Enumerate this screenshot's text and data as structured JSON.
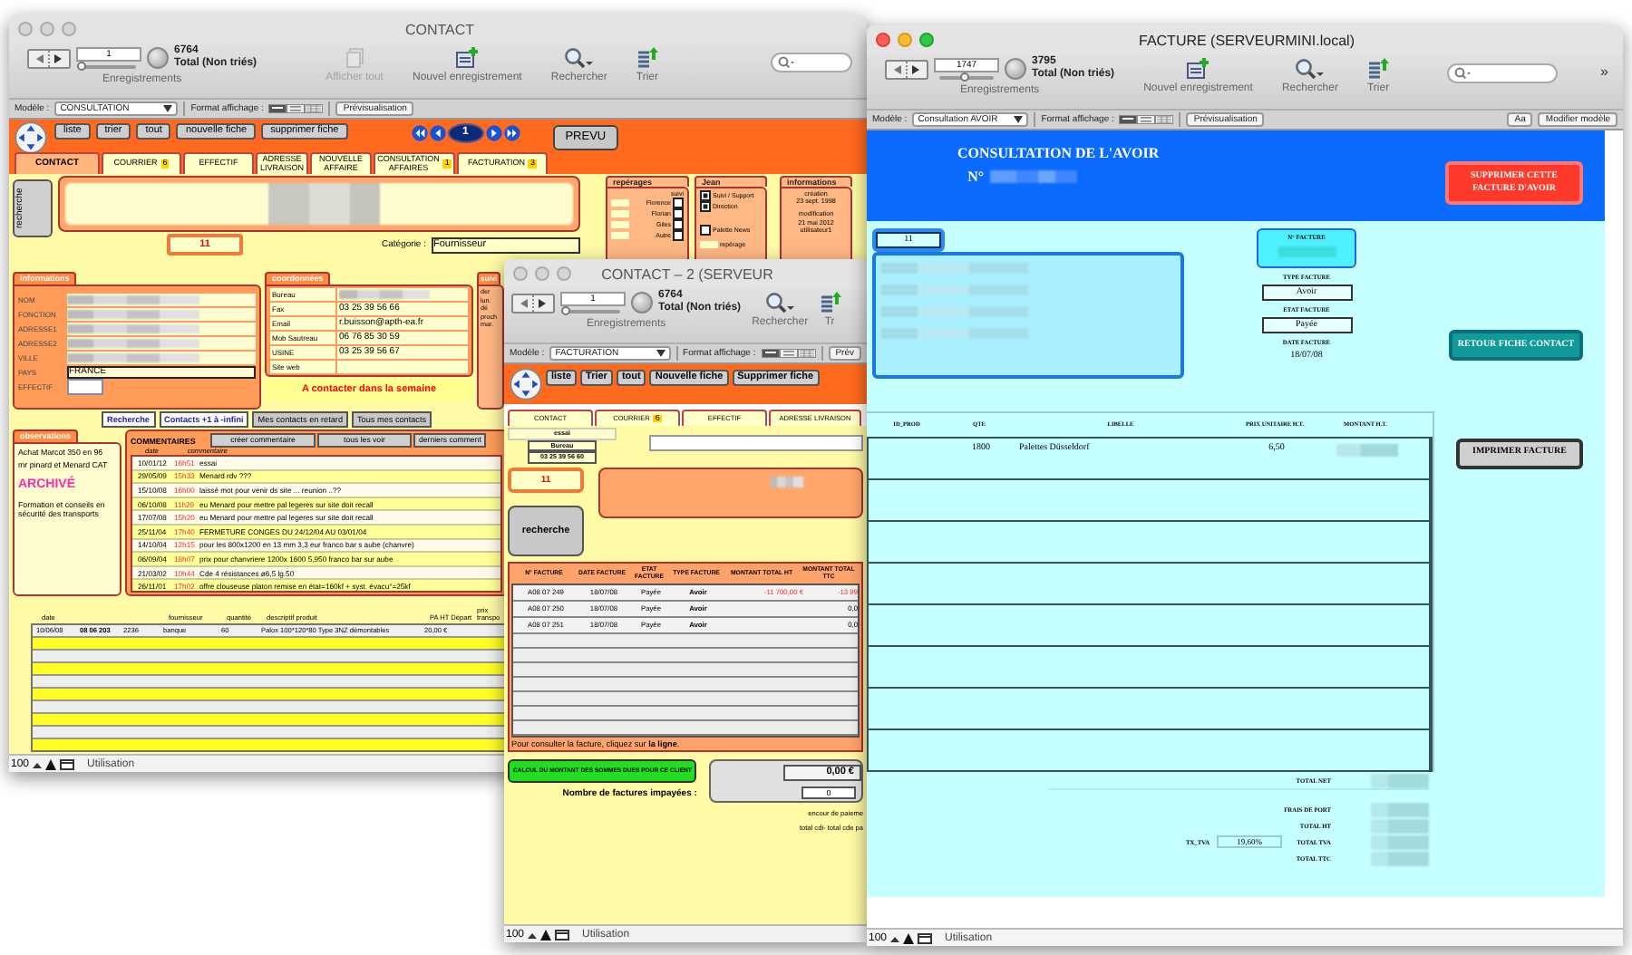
{
  "contact_window": {
    "title": "CONTACT",
    "active": false,
    "toolbar": {
      "record": "1",
      "level": 0,
      "found": "6764",
      "total": "Total (Non triés)",
      "records_label": "Enregistrements",
      "tools": [
        {
          "kind": "show-all",
          "label": "Afficher tout",
          "disabled": true
        },
        {
          "kind": "new",
          "label": "Nouvel enregistrement",
          "disabled": false
        },
        {
          "kind": "search",
          "label": "Rechercher",
          "disabled": false
        },
        {
          "kind": "sort",
          "label": "Trier",
          "disabled": false
        }
      ],
      "search_field": true
    },
    "layout_bar": {
      "layout_label": "Modèle :",
      "layout": "CONSULTATION",
      "format_label": "Format affichage :",
      "view_modes": [
        {
          "kind": "form",
          "selected": true
        },
        {
          "kind": "list",
          "selected": false
        },
        {
          "kind": "table",
          "selected": false
        }
      ],
      "preview": "Prévisualisation"
    },
    "nav_buttons": [
      "liste",
      "trier",
      "tout",
      "nouvelle fiche",
      "supprimer fiche"
    ],
    "page": "1",
    "prevu": "PREVU",
    "tabs": [
      {
        "label": "CONTACT",
        "selected": true
      },
      {
        "label": "COURRIER",
        "badge": "6",
        "selected": false
      },
      {
        "label": "EFFECTIF",
        "selected": false
      },
      {
        "label": "ADRESSE LIVRAISON",
        "selected": false
      },
      {
        "label": "NOUVELLE AFFAIRE",
        "selected": false
      },
      {
        "label": "CONSULTATION AFFAIRES",
        "badge": "1",
        "selected": false
      },
      {
        "label": "FACTURATION",
        "badge": "3",
        "selected": false
      }
    ],
    "search_button": "recherche",
    "category_label": "Catégorie :",
    "category": "Fournisseur",
    "record_number": "11",
    "reperages": {
      "title": "repérages",
      "suivi": "suivi",
      "people": [
        {
          "name": "Florence",
          "checked": false
        },
        {
          "name": "Florian",
          "checked": false
        },
        {
          "name": "Giles",
          "checked": false
        },
        {
          "name": "Autre",
          "checked": false
        }
      ]
    },
    "jean": {
      "title": "Jean",
      "options": [
        {
          "label": "Suivi / Support",
          "checked": true
        },
        {
          "label": "Direction",
          "checked": true
        },
        {
          "label": "Palette News",
          "checked": false
        }
      ],
      "reperage": "repérage"
    },
    "info_box": {
      "title": "informations",
      "created_label": "création",
      "created": "23 sept. 1998",
      "modified_label": "modification",
      "modified": "21 mai 2012",
      "user": "utilisateur1"
    },
    "identity": {
      "title": "informations",
      "fields": [
        {
          "label": "NOM",
          "blurred": true
        },
        {
          "label": "FONCTION",
          "blurred": true
        },
        {
          "label": "ADRESSE1",
          "blurred": true
        },
        {
          "label": "ADRESSE2",
          "blurred": true
        },
        {
          "label": "VILLE",
          "blurred": true
        },
        {
          "label": "PAYS",
          "value": "FRANCE",
          "blurred": false
        },
        {
          "label": "EFFECTIF",
          "blurred": false
        }
      ]
    },
    "coordinates": {
      "title": "coordonnées",
      "fields": [
        {
          "label": "Bureau",
          "blurred": true
        },
        {
          "label": "Fax",
          "value": "03 25 39 56 66",
          "blurred": false
        },
        {
          "label": "Email",
          "value": "r.buisson@apth-ea.fr",
          "blurred": false
        },
        {
          "label": "Mob Sautreau",
          "value": "06 76 85 30 59",
          "blurred": false
        },
        {
          "label": "USINE",
          "value": "03 25 39 56 67",
          "blurred": false
        },
        {
          "label": "Site web",
          "blurred": false
        }
      ]
    },
    "alert": "A contacter dans la semaine",
    "suivi": {
      "title": "suivi",
      "lines": [
        "der",
        "lun.",
        "dé",
        "proch",
        "mar."
      ]
    },
    "contact_buttons": [
      {
        "label": "Recherche",
        "kind": "blue"
      },
      {
        "label": "Contacts +1 à -infini",
        "kind": "blue"
      },
      {
        "label": "Mes contacts en retard",
        "kind": "grey"
      },
      {
        "label": "Tous mes contacts",
        "kind": "grey"
      }
    ],
    "observations": {
      "title": "observations",
      "paragraphs": [
        {
          "text": "Achat Marcot 350 en 96",
          "kind": "plain"
        },
        {
          "text": "mr pinard et Menard CAT",
          "kind": "plain"
        },
        {
          "text": "ARCHIVÉ",
          "kind": "highlight"
        },
        {
          "text": "Formation et conseils en sécurité des transports",
          "kind": "plain"
        }
      ]
    },
    "comments": {
      "title": "COMMENTAIRES",
      "buttons": [
        "créer commentaire",
        "tous les voir",
        "derniers comment"
      ],
      "columns": [
        "date",
        "commentaire"
      ],
      "rows": [
        {
          "date": "10/01/12",
          "time": "16h51",
          "text": "essai"
        },
        {
          "date": "29/05/09",
          "time": "15h33",
          "text": "Menard rdv ???"
        },
        {
          "date": "15/10/08",
          "time": "16h00",
          "text": "laissé mot pour venir ds site ... reunion ..??"
        },
        {
          "date": "06/10/08",
          "time": "11h29",
          "text": "eu Menard pour mettre pal legeres sur site doit recall"
        },
        {
          "date": "17/07/08",
          "time": "15h20",
          "text": "eu Menard pour mettre pal legeres sur site doit recall"
        },
        {
          "date": "25/11/04",
          "time": "17h40",
          "text": "FERMETURE CONGES DU 24/12/04 AU 03/01/04"
        },
        {
          "date": "14/10/04",
          "time": "12h15",
          "text": "pour les 800x1200 en 13 mm 3,3 eur franco bar s aube (chanvre)"
        },
        {
          "date": "06/09/04",
          "time": "18h07",
          "text": "prix pour chanvriere 1200x 1600 5,950 franco bar sur aube"
        },
        {
          "date": "21/03/02",
          "time": "10h44",
          "text": "Cde 4 résistances ø6,5 lg.50"
        },
        {
          "date": "26/11/01",
          "time": "17h02",
          "text": "offre clouseuse platon remise en état=160kf + syst. évacu°=25kf"
        }
      ]
    },
    "purchases": {
      "columns": [
        "date",
        "",
        "",
        "fournisseur",
        "quantité",
        "descriptif produit",
        "PA HT Départ",
        "prix transpo"
      ],
      "rows": [
        [
          "10/06/08",
          "08 06 203",
          "2236",
          "banque",
          "60",
          "Palox 100*120*80 Type 3NZ démontables",
          "20,00 €",
          ""
        ]
      ]
    },
    "status": {
      "zoom": "100",
      "mode": "Utilisation"
    }
  },
  "contact2_window": {
    "title": "CONTACT – 2 (SERVEUR",
    "active": false,
    "toolbar": {
      "record": "1",
      "level": 0,
      "found": "6764",
      "total": "Total (Non triés)",
      "records_label": "Enregistrements",
      "tools": [
        {
          "kind": "search",
          "label": "Rechercher",
          "disabled": false
        },
        {
          "kind": "sort",
          "label": "Tr",
          "disabled": false
        }
      ]
    },
    "layout_bar": {
      "layout_label": "Modèle :",
      "layout": "FACTURATION",
      "format_label": "Format affichage :",
      "view_modes": [
        {
          "kind": "form",
          "selected": true
        },
        {
          "kind": "list",
          "selected": false
        },
        {
          "kind": "table",
          "selected": false
        }
      ],
      "preview": "Prév"
    },
    "nav_buttons": [
      "liste",
      "Trier",
      "tout",
      "Nouvelle fiche",
      "Supprimer fiche"
    ],
    "tabs": [
      {
        "label": "CONTACT",
        "selected": false
      },
      {
        "label": "COURRIER",
        "badge": "6",
        "selected": false
      },
      {
        "label": "EFFECTIF",
        "selected": false
      },
      {
        "label": "ADRESSE LIVRAISON",
        "selected": false
      }
    ],
    "last_comment": "essai",
    "phone_label": "Bureau",
    "phone": "03 25 39 56 60",
    "record_number": "11",
    "search_button": "recherche",
    "invoices": {
      "columns": [
        "N° FACTURE",
        "DATE FACTURE",
        "ETAT FACTURE",
        "TYPE FACTURE",
        "MONTANT TOTAL HT",
        "MONTANT TOTAL TTC"
      ],
      "rows": [
        {
          "cells": [
            "A08 07 249",
            "18/07/08",
            "Payée",
            "Avoir",
            "-11 700,00 €",
            "-13 99"
          ],
          "negative": true
        },
        {
          "cells": [
            "A08 07 250",
            "18/07/08",
            "Payée",
            "Avoir",
            "",
            "0,0"
          ],
          "negative": false
        },
        {
          "cells": [
            "A08 07 251",
            "18/07/08",
            "Payée",
            "Avoir",
            "",
            "0,0"
          ],
          "negative": false
        }
      ]
    },
    "hint": "Pour consulter la facture, cliquez sur **la ligne**.",
    "calc_button": "CALCUL DU MONTANT DES SOMMES DUES POUR CE CLIENT",
    "amount_due": "0,00 €",
    "unpaid_label": "Nombre de factures impayées :",
    "unpaid": "0",
    "notes": [
      "encour de paieme",
      "total cdi- total cde pa"
    ],
    "status": {
      "zoom": "100",
      "mode": "Utilisation"
    }
  },
  "facture_window": {
    "title": "FACTURE (SERVEURMINI.local)",
    "active": true,
    "toolbar": {
      "record": "1747",
      "level": 0.46,
      "found": "3795",
      "total": "Total (Non triés)",
      "records_label": "Enregistrements",
      "tools": [
        {
          "kind": "new",
          "label": "Nouvel enregistrement",
          "disabled": false
        },
        {
          "kind": "search",
          "label": "Rechercher",
          "disabled": false
        },
        {
          "kind": "sort",
          "label": "Trier",
          "disabled": false
        }
      ],
      "search_field": true,
      "overflow": "»"
    },
    "layout_bar": {
      "layout_label": "Modèle :",
      "layout": "Consultation AVOIR",
      "format_label": "Format affichage :",
      "view_modes": [
        {
          "kind": "form",
          "selected": true
        },
        {
          "kind": "list",
          "selected": false
        },
        {
          "kind": "table",
          "selected": false
        }
      ],
      "preview": "Prévisualisation",
      "font_button": "Aa",
      "edit_layout": "Modifier modèle"
    },
    "heading": "CONSULTATION DE L'AVOIR",
    "number_label": "N°",
    "delete_button": "SUPPRIMER CETTE FACTURE D'AVOIR",
    "record_number": "11",
    "invoice_fields": [
      {
        "label": "N° FACTURE",
        "blurred": true,
        "kind": "badge"
      },
      {
        "label": "TYPE FACTURE",
        "value": "Avoir",
        "blurred": false,
        "kind": "field"
      },
      {
        "label": "ETAT FACTURE",
        "value": "Payée",
        "blurred": false,
        "kind": "field"
      },
      {
        "label": "DATE FACTURE",
        "value": "18/07/08",
        "blurred": false,
        "kind": "plain"
      }
    ],
    "back_button": "RETOUR FICHE CONTACT",
    "print_button": "IMPRIMER FACTURE",
    "lines": {
      "columns": [
        "ID_PROD",
        "QTE",
        "LIBELLE",
        "PRIX UNITAIRE H.T.",
        "MONTANT H.T."
      ],
      "rows": [
        {
          "qty": "1800",
          "label": "Palettes Düsseldorf",
          "price": "6,50",
          "amount_blurred": true
        }
      ]
    },
    "totals": [
      {
        "label": "TOTAL NET"
      },
      {
        "label": "FRAIS DE PORT"
      },
      {
        "label": "TOTAL HT"
      },
      {
        "label": "TOTAL TVA"
      },
      {
        "label": "TOTAL TTC"
      }
    ],
    "vat_label": "TX_TVA",
    "vat": "19,60%",
    "status": {
      "zoom": "100",
      "mode": "Utilisation"
    }
  }
}
